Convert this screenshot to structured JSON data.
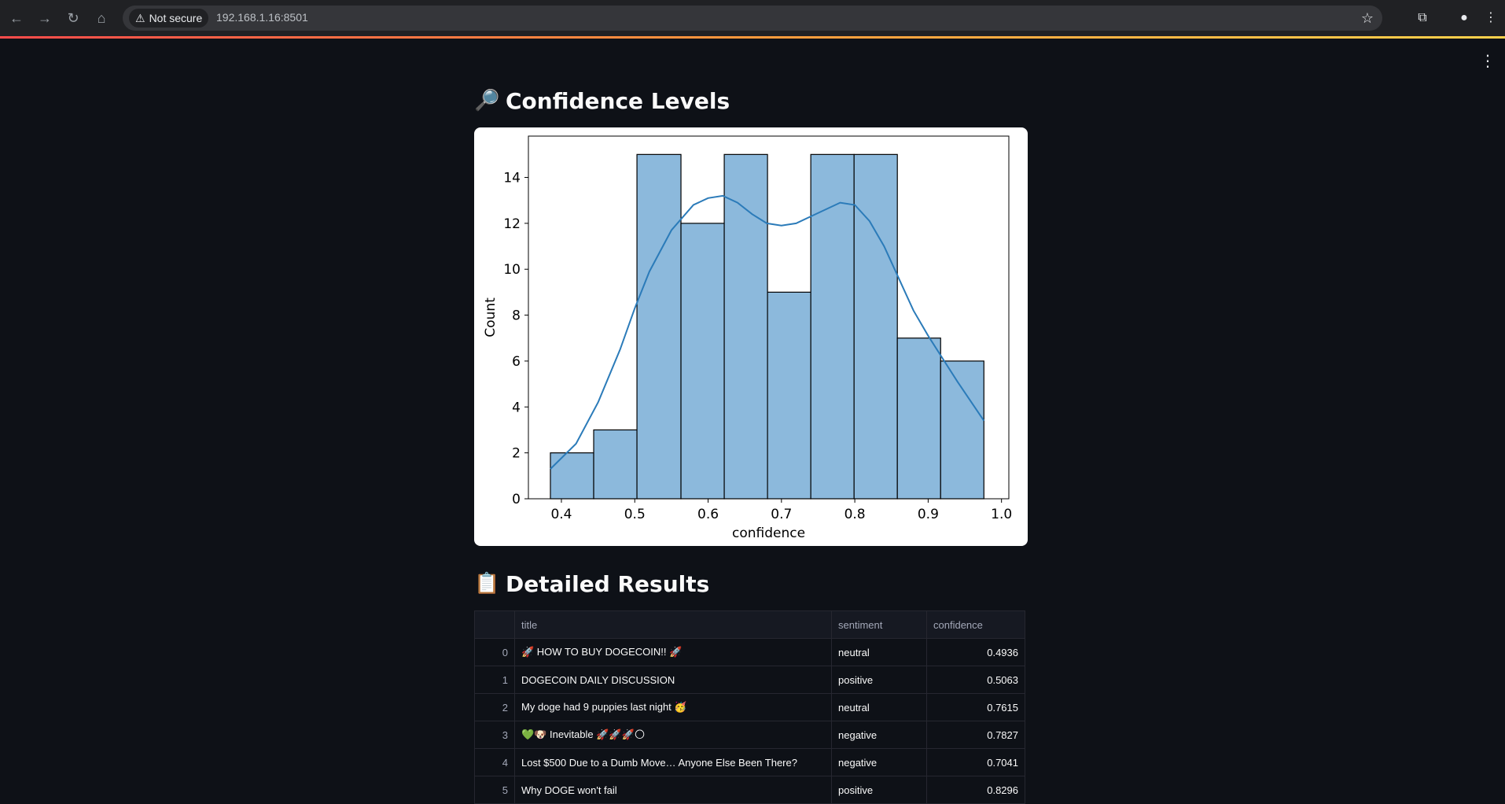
{
  "browser": {
    "security_label": "Not secure",
    "url": "192.168.1.16:8501"
  },
  "sections": {
    "confidence_title": "Confidence Levels",
    "confidence_icon": "magnifying-glass-icon",
    "results_title": "Detailed Results",
    "results_icon": "clipboard-icon"
  },
  "chart_data": {
    "type": "bar",
    "subtype": "histogram-with-kde",
    "xlabel": "confidence",
    "ylabel": "Count",
    "xlim": [
      0.355,
      1.01
    ],
    "ylim": [
      0,
      15.8
    ],
    "xticks": [
      0.4,
      0.5,
      0.6,
      0.7,
      0.8,
      0.9,
      1.0
    ],
    "xtick_labels": [
      "0.4",
      "0.5",
      "0.6",
      "0.7",
      "0.8",
      "0.9",
      "1.0"
    ],
    "yticks": [
      0,
      2,
      4,
      6,
      8,
      10,
      12,
      14
    ],
    "bins": [
      {
        "start": 0.385,
        "end": 0.444,
        "count": 2
      },
      {
        "start": 0.444,
        "end": 0.503,
        "count": 3
      },
      {
        "start": 0.503,
        "end": 0.563,
        "count": 15
      },
      {
        "start": 0.563,
        "end": 0.622,
        "count": 12
      },
      {
        "start": 0.622,
        "end": 0.681,
        "count": 15
      },
      {
        "start": 0.681,
        "end": 0.74,
        "count": 9
      },
      {
        "start": 0.74,
        "end": 0.799,
        "count": 15
      },
      {
        "start": 0.799,
        "end": 0.858,
        "count": 15
      },
      {
        "start": 0.858,
        "end": 0.917,
        "count": 7
      },
      {
        "start": 0.917,
        "end": 0.976,
        "count": 6
      }
    ],
    "kde": {
      "x": [
        0.385,
        0.42,
        0.45,
        0.48,
        0.5,
        0.52,
        0.55,
        0.58,
        0.6,
        0.62,
        0.64,
        0.66,
        0.68,
        0.7,
        0.72,
        0.74,
        0.76,
        0.78,
        0.8,
        0.82,
        0.84,
        0.86,
        0.88,
        0.9,
        0.92,
        0.94,
        0.976
      ],
      "y": [
        1.3,
        2.4,
        4.2,
        6.5,
        8.3,
        9.9,
        11.7,
        12.8,
        13.1,
        13.2,
        12.9,
        12.4,
        12.0,
        11.9,
        12.0,
        12.3,
        12.6,
        12.9,
        12.8,
        12.1,
        11.0,
        9.6,
        8.2,
        7.1,
        6.1,
        5.1,
        3.4
      ]
    },
    "bar_color": "#8cb9dc",
    "line_color": "#2b7bb9"
  },
  "table": {
    "columns": [
      "",
      "title",
      "sentiment",
      "confidence"
    ],
    "rows": [
      {
        "index": "0",
        "title": "🚀 HOW TO BUY DOGECOIN!! 🚀",
        "sentiment": "neutral",
        "confidence": "0.4936"
      },
      {
        "index": "1",
        "title": "DOGECOIN DAILY DISCUSSION",
        "sentiment": "positive",
        "confidence": "0.5063"
      },
      {
        "index": "2",
        "title": "My doge had 9 puppies last night 🥳",
        "sentiment": "neutral",
        "confidence": "0.7615"
      },
      {
        "index": "3",
        "title": "💚🐶 Inevitable 🚀🚀🚀🌕",
        "sentiment": "negative",
        "confidence": "0.7827"
      },
      {
        "index": "4",
        "title": "Lost $500 Due to a Dumb Move… Anyone Else Been There?",
        "sentiment": "negative",
        "confidence": "0.7041"
      },
      {
        "index": "5",
        "title": "Why DOGE won't fail",
        "sentiment": "positive",
        "confidence": "0.8296"
      }
    ]
  }
}
